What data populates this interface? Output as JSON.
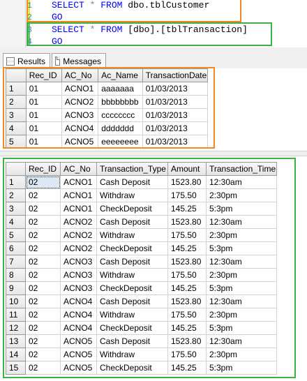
{
  "editor": {
    "lines": [
      {
        "num": "1",
        "kw1": "SELECT",
        "star": " * ",
        "kw2": "FROM",
        "rest": " dbo.tblCustomer"
      },
      {
        "num": "2",
        "kw1": "GO",
        "star": "",
        "kw2": "",
        "rest": ""
      },
      {
        "num": "3",
        "kw1": "SELECT",
        "star": " * ",
        "kw2": "FROM",
        "rest": " [dbo].[tblTransaction]"
      },
      {
        "num": "4",
        "kw1": "GO",
        "star": "",
        "kw2": "",
        "rest": ""
      }
    ]
  },
  "tabs": {
    "results": "Results",
    "messages": "Messages"
  },
  "grid1": {
    "columns": [
      "Rec_ID",
      "AC_No",
      "Ac_Name",
      "TransactionDate"
    ],
    "rows": [
      [
        "1",
        "01",
        "ACNO1",
        "aaaaaaa",
        "01/03/2013"
      ],
      [
        "2",
        "01",
        "ACNO2",
        "bbbbbbbb",
        "01/03/2013"
      ],
      [
        "3",
        "01",
        "ACNO3",
        "cccccccc",
        "01/03/2013"
      ],
      [
        "4",
        "01",
        "ACNO4",
        "ddddddd",
        "01/03/2013"
      ],
      [
        "5",
        "01",
        "ACNO5",
        "eeeeeeee",
        "01/03/2013"
      ]
    ]
  },
  "grid2": {
    "columns": [
      "Rec_ID",
      "AC_No",
      "Transaction_Type",
      "Amount",
      "Transaction_Time"
    ],
    "rows": [
      [
        "1",
        "02",
        "ACNO1",
        "Cash Deposit",
        "1523.80",
        "12:30am"
      ],
      [
        "2",
        "02",
        "ACNO1",
        "Withdraw",
        "175.50",
        "2:30pm"
      ],
      [
        "3",
        "02",
        "ACNO1",
        "CheckDeposit",
        "145.25",
        "5:3pm"
      ],
      [
        "4",
        "02",
        "ACNO2",
        "Cash Deposit",
        "1523.80",
        "12:30am"
      ],
      [
        "5",
        "02",
        "ACNO2",
        "Withdraw",
        "175.50",
        "2:30pm"
      ],
      [
        "6",
        "02",
        "ACNO2",
        "CheckDeposit",
        "145.25",
        "5:3pm"
      ],
      [
        "7",
        "02",
        "ACNO3",
        "Cash Deposit",
        "1523.80",
        "12:30am"
      ],
      [
        "8",
        "02",
        "ACNO3",
        "Withdraw",
        "175.50",
        "2:30pm"
      ],
      [
        "9",
        "02",
        "ACNO3",
        "CheckDeposit",
        "145.25",
        "5:3pm"
      ],
      [
        "10",
        "02",
        "ACNO4",
        "Cash Deposit",
        "1523.80",
        "12:30am"
      ],
      [
        "11",
        "02",
        "ACNO4",
        "Withdraw",
        "175.50",
        "2:30pm"
      ],
      [
        "12",
        "02",
        "ACNO4",
        "CheckDeposit",
        "145.25",
        "5:3pm"
      ],
      [
        "13",
        "02",
        "ACNO5",
        "Cash Deposit",
        "1523.80",
        "12:30am"
      ],
      [
        "14",
        "02",
        "ACNO5",
        "Withdraw",
        "175.50",
        "2:30pm"
      ],
      [
        "15",
        "02",
        "ACNO5",
        "CheckDeposit",
        "145.25",
        "5:3pm"
      ]
    ]
  },
  "colors": {
    "keyword": "#0000ff",
    "line_number": "#2b91af",
    "highlight_orange": "#f08a24",
    "highlight_green": "#3cb043"
  }
}
